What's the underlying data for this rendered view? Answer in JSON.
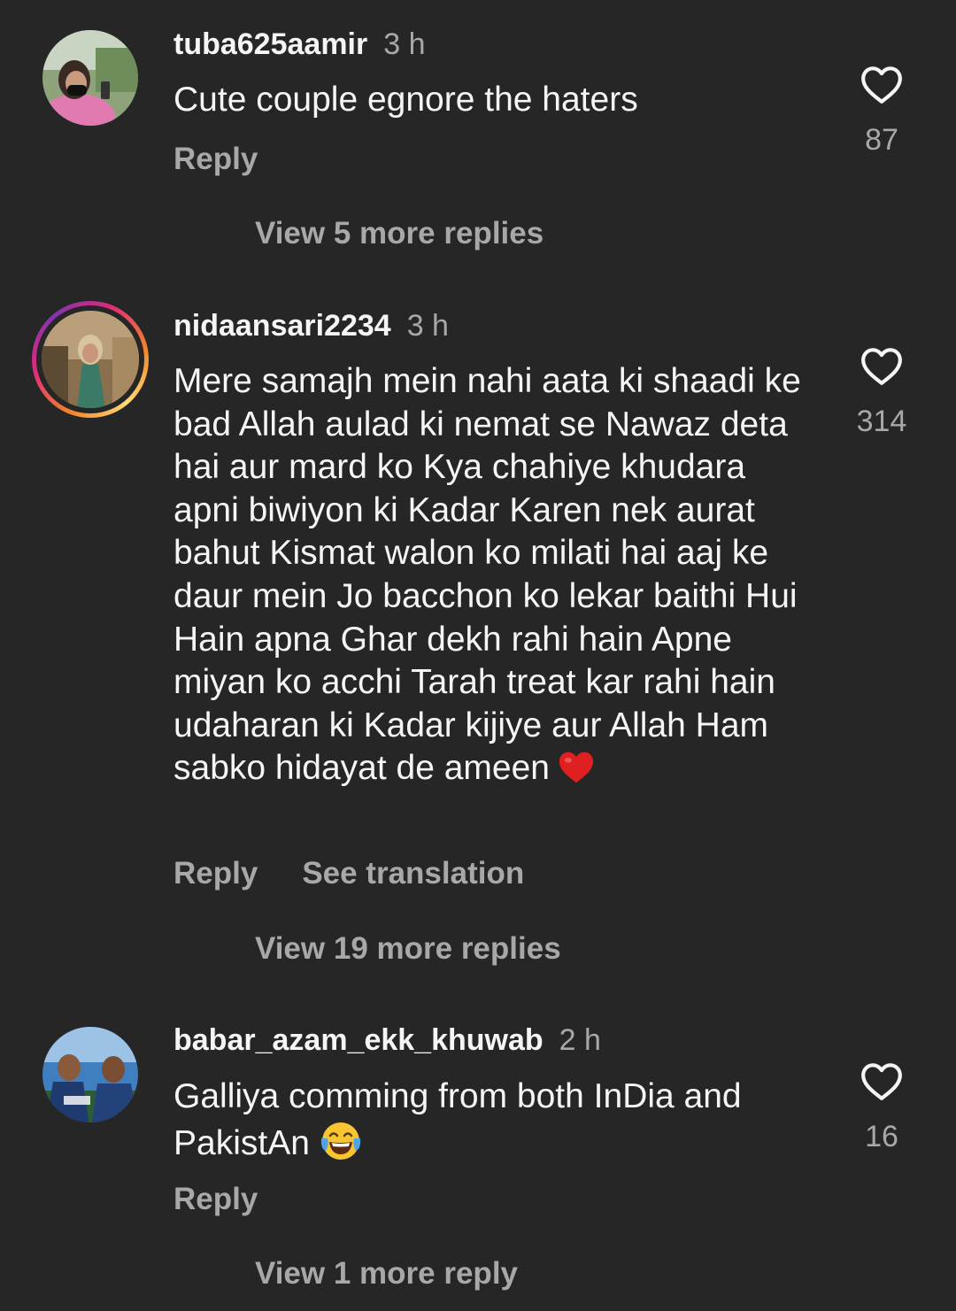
{
  "comments": [
    {
      "username": "tuba625aamir",
      "time": "3 h",
      "text": "Cute couple egnore the haters",
      "likes": "87",
      "reply_label": "Reply",
      "view_more": "View 5 more replies",
      "avatar_icon": "profile-photo-woman-with-phone"
    },
    {
      "username": "nidaansari2234",
      "time": "3 h",
      "text": "Mere samajh mein nahi aata ki shaadi ke bad Allah aulad ki nemat se Nawaz deta hai aur mard ko Kya chahiye khudara apni biwiyon ki Kadar Karen nek aurat bahut Kismat walon ko milati hai aaj ke daur mein Jo bacchon ko lekar baithi Hui Hain apna Ghar dekh rahi hain Apne miyan ko acchi Tarah treat kar rahi hain udaharan ki Kadar kijiye aur Allah Ham sabko hidayat de ameen",
      "emoji": "red-heart",
      "likes": "314",
      "reply_label": "Reply",
      "translate_label": "See translation",
      "view_more": "View 19 more replies",
      "has_story": true,
      "avatar_icon": "profile-photo-woman-in-green"
    },
    {
      "username": "babar_azam_ekk_khuwab",
      "time": "2 h",
      "text": "Galliya comming from both InDia and PakistAn",
      "emoji": "face-with-tears-of-joy",
      "likes": "16",
      "reply_label": "Reply",
      "view_more": "View 1 more reply",
      "avatar_icon": "profile-photo-cricketers"
    }
  ],
  "colors": {
    "background": "#262626",
    "primary_text": "#f5f5f5",
    "secondary_text": "#a8a8a8"
  }
}
